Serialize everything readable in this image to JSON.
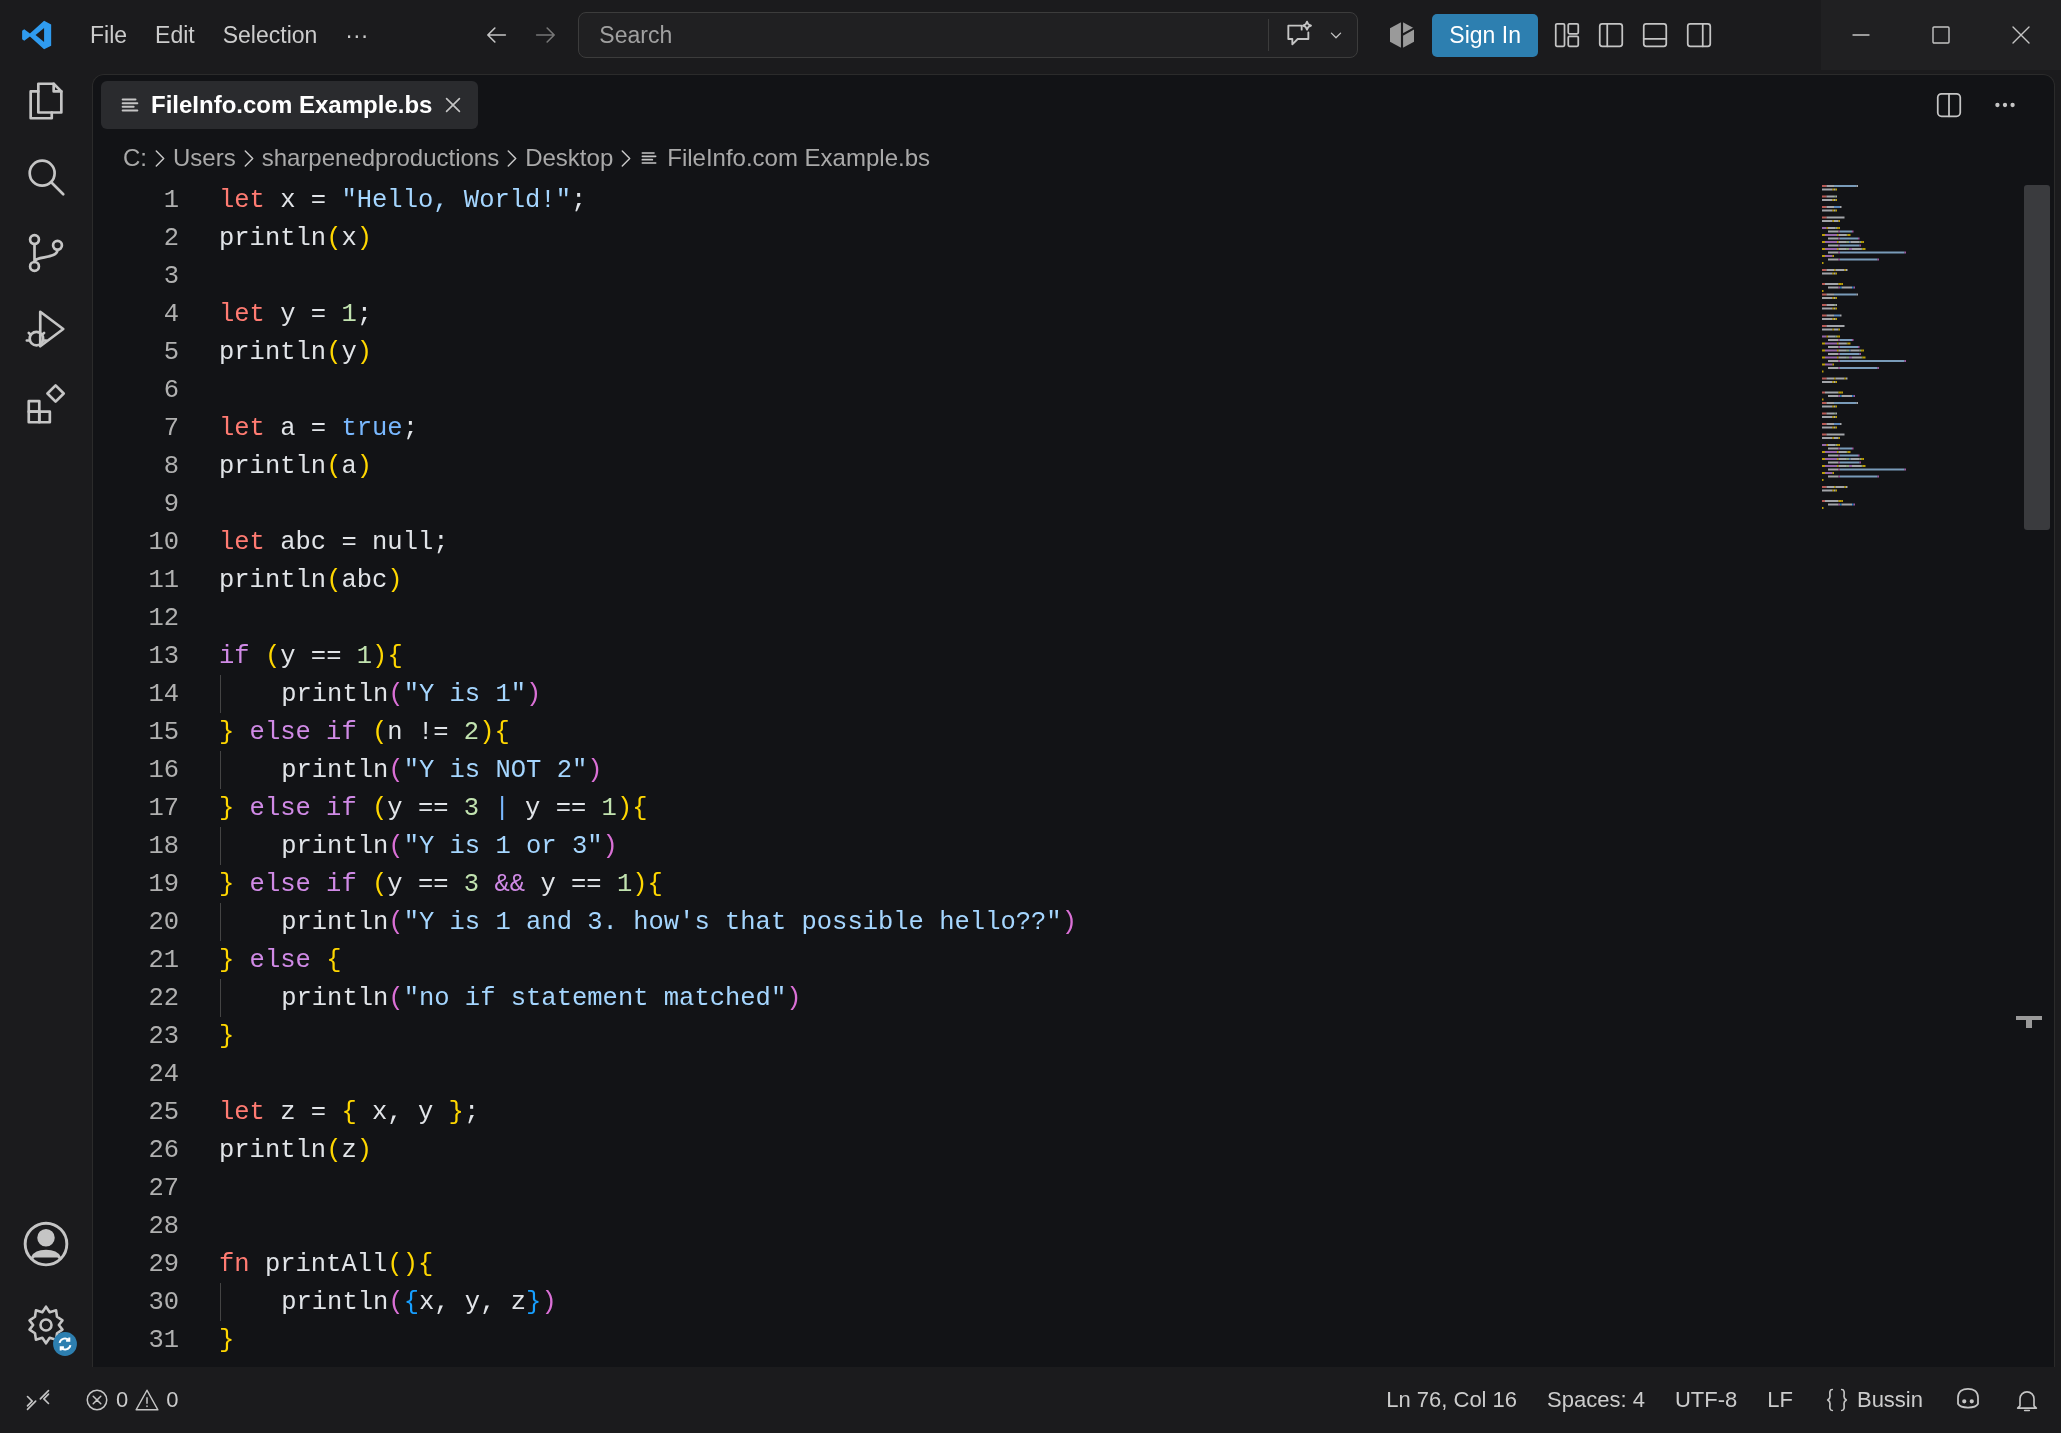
{
  "menu": [
    "File",
    "Edit",
    "Selection",
    "···"
  ],
  "search": {
    "placeholder": "Search"
  },
  "sign_in": "Sign In",
  "tab": {
    "label": "FileInfo.com Example.bs",
    "selected": true
  },
  "breadcrumbs": [
    "C:",
    "Users",
    "sharpenedproductions",
    "Desktop",
    "FileInfo.com Example.bs"
  ],
  "lines": [
    {
      "number": "1",
      "tokens": [
        {
          "kind": "kw",
          "text": "let"
        },
        {
          "kind": "txt",
          "text": " x = "
        },
        {
          "kind": "str",
          "text": "\"Hello, World!\""
        },
        {
          "kind": "txt",
          "text": ";"
        }
      ]
    },
    {
      "number": "2",
      "tokens": [
        {
          "kind": "txt",
          "text": "println"
        },
        {
          "kind": "b1",
          "text": "("
        },
        {
          "kind": "txt",
          "text": "x"
        },
        {
          "kind": "b1",
          "text": ")"
        }
      ]
    },
    {
      "number": "3"
    },
    {
      "number": "4",
      "tokens": [
        {
          "kind": "kw",
          "text": "let"
        },
        {
          "kind": "txt",
          "text": " y = "
        },
        {
          "kind": "num",
          "text": "1"
        },
        {
          "kind": "txt",
          "text": ";"
        }
      ]
    },
    {
      "number": "5",
      "tokens": [
        {
          "kind": "txt",
          "text": "println"
        },
        {
          "kind": "b1",
          "text": "("
        },
        {
          "kind": "txt",
          "text": "y"
        },
        {
          "kind": "b1",
          "text": ")"
        }
      ]
    },
    {
      "number": "6"
    },
    {
      "number": "7",
      "tokens": [
        {
          "kind": "kw",
          "text": "let"
        },
        {
          "kind": "txt",
          "text": " a = "
        },
        {
          "kind": "const",
          "text": "true"
        },
        {
          "kind": "txt",
          "text": ";"
        }
      ]
    },
    {
      "number": "8",
      "tokens": [
        {
          "kind": "txt",
          "text": "println"
        },
        {
          "kind": "b1",
          "text": "("
        },
        {
          "kind": "txt",
          "text": "a"
        },
        {
          "kind": "b1",
          "text": ")"
        }
      ]
    },
    {
      "number": "9"
    },
    {
      "number": "10",
      "tokens": [
        {
          "kind": "kw",
          "text": "let"
        },
        {
          "kind": "txt",
          "text": " abc = null;"
        }
      ]
    },
    {
      "number": "11",
      "tokens": [
        {
          "kind": "txt",
          "text": "println"
        },
        {
          "kind": "b1",
          "text": "("
        },
        {
          "kind": "txt",
          "text": "abc"
        },
        {
          "kind": "b1",
          "text": ")"
        }
      ]
    },
    {
      "number": "12"
    },
    {
      "number": "13",
      "tokens": [
        {
          "kind": "ctl",
          "text": "if "
        },
        {
          "kind": "b1",
          "text": "("
        },
        {
          "kind": "txt",
          "text": "y == "
        },
        {
          "kind": "num",
          "text": "1"
        },
        {
          "kind": "b1",
          "text": ")"
        },
        {
          "kind": "b1",
          "text": "{"
        }
      ]
    },
    {
      "number": "14",
      "guide": true,
      "tokens": [
        {
          "kind": "txt",
          "text": "println"
        },
        {
          "kind": "b2",
          "text": "("
        },
        {
          "kind": "str",
          "text": "\"Y is 1\""
        },
        {
          "kind": "b2",
          "text": ")"
        }
      ]
    },
    {
      "number": "15",
      "tokens": [
        {
          "kind": "b1",
          "text": "} "
        },
        {
          "kind": "ctl",
          "text": "else if "
        },
        {
          "kind": "b1",
          "text": "("
        },
        {
          "kind": "txt",
          "text": "n != "
        },
        {
          "kind": "num",
          "text": "2"
        },
        {
          "kind": "b1",
          "text": ")"
        },
        {
          "kind": "b1",
          "text": "{"
        }
      ]
    },
    {
      "number": "16",
      "guide": true,
      "tokens": [
        {
          "kind": "txt",
          "text": "println"
        },
        {
          "kind": "b2",
          "text": "("
        },
        {
          "kind": "str",
          "text": "\"Y is NOT 2\""
        },
        {
          "kind": "b2",
          "text": ")"
        }
      ]
    },
    {
      "number": "17",
      "tokens": [
        {
          "kind": "b1",
          "text": "} "
        },
        {
          "kind": "ctl",
          "text": "else if "
        },
        {
          "kind": "b1",
          "text": "("
        },
        {
          "kind": "txt",
          "text": "y == "
        },
        {
          "kind": "num",
          "text": "3 "
        },
        {
          "kind": "const",
          "text": "|"
        },
        {
          "kind": "txt",
          "text": " y == "
        },
        {
          "kind": "num",
          "text": "1"
        },
        {
          "kind": "b1",
          "text": ")"
        },
        {
          "kind": "b1",
          "text": "{"
        }
      ]
    },
    {
      "number": "18",
      "guide": true,
      "tokens": [
        {
          "kind": "txt",
          "text": "println"
        },
        {
          "kind": "b2",
          "text": "("
        },
        {
          "kind": "str",
          "text": "\"Y is 1 or 3\""
        },
        {
          "kind": "b2",
          "text": ")"
        }
      ]
    },
    {
      "number": "19",
      "tokens": [
        {
          "kind": "b1",
          "text": "} "
        },
        {
          "kind": "ctl",
          "text": "else if "
        },
        {
          "kind": "b1",
          "text": "("
        },
        {
          "kind": "txt",
          "text": "y == "
        },
        {
          "kind": "num",
          "text": "3 "
        },
        {
          "kind": "ctl",
          "text": "&&"
        },
        {
          "kind": "txt",
          "text": " y == "
        },
        {
          "kind": "num",
          "text": "1"
        },
        {
          "kind": "b1",
          "text": ")"
        },
        {
          "kind": "b1",
          "text": "{"
        }
      ]
    },
    {
      "number": "20",
      "guide": true,
      "tokens": [
        {
          "kind": "txt",
          "text": "println"
        },
        {
          "kind": "b2",
          "text": "("
        },
        {
          "kind": "str",
          "text": "\"Y is 1 and 3. how's that possible hello??\""
        },
        {
          "kind": "b2",
          "text": ")"
        }
      ]
    },
    {
      "number": "21",
      "tokens": [
        {
          "kind": "b1",
          "text": "} "
        },
        {
          "kind": "ctl",
          "text": "else "
        },
        {
          "kind": "b1",
          "text": "{"
        }
      ]
    },
    {
      "number": "22",
      "guide": true,
      "tokens": [
        {
          "kind": "txt",
          "text": "println"
        },
        {
          "kind": "b2",
          "text": "("
        },
        {
          "kind": "str",
          "text": "\"no if statement matched\""
        },
        {
          "kind": "b2",
          "text": ")"
        }
      ]
    },
    {
      "number": "23",
      "tokens": [
        {
          "kind": "b1",
          "text": "}"
        }
      ]
    },
    {
      "number": "24"
    },
    {
      "number": "25",
      "tokens": [
        {
          "kind": "kw",
          "text": "let"
        },
        {
          "kind": "txt",
          "text": " z = "
        },
        {
          "kind": "b1",
          "text": "{"
        },
        {
          "kind": "txt",
          "text": " x, y "
        },
        {
          "kind": "b1",
          "text": "}"
        },
        {
          "kind": "txt",
          "text": ";"
        }
      ]
    },
    {
      "number": "26",
      "tokens": [
        {
          "kind": "txt",
          "text": "println"
        },
        {
          "kind": "b1",
          "text": "("
        },
        {
          "kind": "txt",
          "text": "z"
        },
        {
          "kind": "b1",
          "text": ")"
        }
      ]
    },
    {
      "number": "27"
    },
    {
      "number": "28"
    },
    {
      "number": "29",
      "tokens": [
        {
          "kind": "kw",
          "text": "fn"
        },
        {
          "kind": "txt",
          "text": " printAll"
        },
        {
          "kind": "b1",
          "text": "("
        },
        {
          "kind": "b1",
          "text": ")"
        },
        {
          "kind": "b1",
          "text": "{"
        }
      ]
    },
    {
      "number": "30",
      "guide": true,
      "tokens": [
        {
          "kind": "txt",
          "text": "println"
        },
        {
          "kind": "b2",
          "text": "("
        },
        {
          "kind": "b3",
          "text": "{"
        },
        {
          "kind": "txt",
          "text": "x, y, z"
        },
        {
          "kind": "b3",
          "text": "}"
        },
        {
          "kind": "b2",
          "text": ")"
        }
      ]
    },
    {
      "number": "31",
      "tokens": [
        {
          "kind": "b1",
          "text": "}"
        }
      ]
    }
  ],
  "status_bar": {
    "errors": "0",
    "warnings": "0",
    "position": "Ln 76, Col 16",
    "spaces": "Spaces: 4",
    "encoding": "UTF-8",
    "eol": "LF",
    "language": "Bussin"
  }
}
